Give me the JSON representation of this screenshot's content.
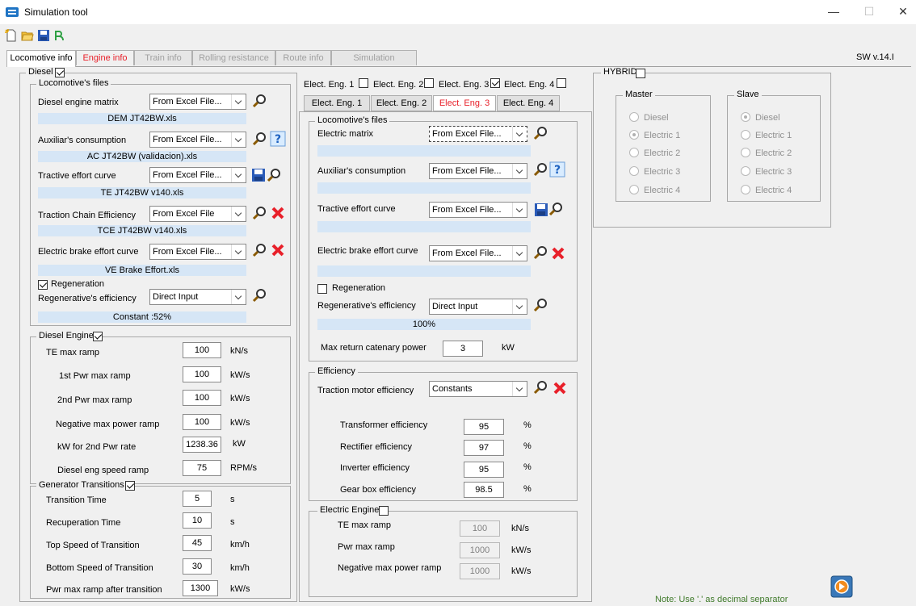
{
  "window": {
    "title": "Simulation tool",
    "minimize": "—",
    "maximize": "☐",
    "close": "✕"
  },
  "colors": {
    "accent_red": "#e8202a",
    "file_bar": "#d6e6f6",
    "logo_blue": "#1f74c4"
  },
  "tabs": [
    {
      "label": "Locomotive info"
    },
    {
      "label": "Engine info"
    },
    {
      "label": "Train info"
    },
    {
      "label": "Rolling resistance"
    },
    {
      "label": "Route info"
    },
    {
      "label": "Simulation"
    }
  ],
  "version": "SW v.14.I",
  "diesel": {
    "title": "Diesel",
    "files": {
      "title": "Locomotive's files",
      "rows": [
        {
          "label": "Diesel engine matrix",
          "combo": "From Excel File...",
          "file": "DEM JT42BW.xls"
        },
        {
          "label": "Auxiliar's consumption",
          "combo": "From Excel File...",
          "file": "AC JT42BW (validacion).xls"
        },
        {
          "label": "Tractive effort curve",
          "combo": "From Excel File...",
          "file": "TE JT42BW v140.xls"
        },
        {
          "label": "Traction Chain Efficiency",
          "combo": "From Excel File",
          "file": "TCE JT42BW v140.xls"
        },
        {
          "label": "Electric brake effort curve",
          "combo": "From Excel File...",
          "file": "VE Brake Effort.xls"
        }
      ],
      "regen_label": "Regeneration",
      "regen_eff_label": "Regenerative's  efficiency",
      "regen_combo": "Direct Input",
      "regen_value": "Constant :52%"
    },
    "engine": {
      "title": "Diesel Engine",
      "rows": [
        {
          "label": "TE max ramp",
          "value": "100",
          "unit": "kN/s"
        },
        {
          "label": "1st Pwr max ramp",
          "value": "100",
          "unit": "kW/s"
        },
        {
          "label": "2nd Pwr max ramp",
          "value": "100",
          "unit": "kW/s"
        },
        {
          "label": "Negative max power ramp",
          "value": "100",
          "unit": "kW/s"
        },
        {
          "label": "kW for 2nd Pwr rate",
          "value": "1238.36",
          "unit": "kW"
        },
        {
          "label": "Diesel eng speed ramp",
          "value": "75",
          "unit": "RPM/s"
        }
      ]
    },
    "generator": {
      "title": "Generator Transitions",
      "rows": [
        {
          "label": "Transition Time",
          "value": "5",
          "unit": "s"
        },
        {
          "label": "Recuperation Time",
          "value": "10",
          "unit": "s"
        },
        {
          "label": "Top Speed of Transition",
          "value": "45",
          "unit": "km/h"
        },
        {
          "label": "Bottom Speed of Transition",
          "value": "30",
          "unit": "km/h"
        },
        {
          "label": "Pwr max ramp after transition",
          "value": "1300",
          "unit": "kW/s"
        }
      ]
    }
  },
  "electric": {
    "engine_checks": [
      {
        "label": "Elect. Eng. 1",
        "checked": false
      },
      {
        "label": "Elect. Eng. 2",
        "checked": false
      },
      {
        "label": "Elect. Eng. 3",
        "checked": true
      },
      {
        "label": "Elect. Eng. 4",
        "checked": false
      }
    ],
    "engine_tabs": [
      "Elect. Eng. 1",
      "Elect. Eng. 2",
      "Elect. Eng. 3",
      "Elect. Eng. 4"
    ],
    "files": {
      "title": "Locomotive's files",
      "rows": [
        {
          "label": "Electric  matrix",
          "combo": "From Excel File..."
        },
        {
          "label": "Auxiliar's consumption",
          "combo": "From Excel File..."
        },
        {
          "label": "Tractive effort curve",
          "combo": "From Excel File..."
        },
        {
          "label": "Electric brake effort curve",
          "combo": "From Excel File..."
        }
      ],
      "regen_label": "Regeneration",
      "regen_eff_label": "Regenerative's  efficiency",
      "regen_combo": "Direct Input",
      "regen_value": "100%",
      "catenary_label": "Max return catenary power",
      "catenary_value": "3",
      "catenary_unit": "kW"
    },
    "efficiency": {
      "title": "Efficiency",
      "motor_label": "Traction motor efficiency",
      "motor_combo": "Constants",
      "rows": [
        {
          "label": "Transformer efficiency",
          "value": "95",
          "unit": "%"
        },
        {
          "label": "Rectifier efficiency",
          "value": "97",
          "unit": "%"
        },
        {
          "label": "Inverter efficiency",
          "value": "95",
          "unit": "%"
        },
        {
          "label": "Gear box efficiency",
          "value": "98.5",
          "unit": "%"
        }
      ]
    },
    "engine": {
      "title": "Electric Engine",
      "rows": [
        {
          "label": "TE max ramp",
          "value": "100",
          "unit": "kN/s"
        },
        {
          "label": "Pwr max ramp",
          "value": "1000",
          "unit": "kW/s"
        },
        {
          "label": "Negative max power ramp",
          "value": "1000",
          "unit": "kW/s"
        }
      ]
    }
  },
  "hybrid": {
    "title": "HYBRID",
    "master": {
      "title": "Master",
      "options": [
        "Diesel",
        "Electric 1",
        "Electric 2",
        "Electric 3",
        "Electric 4"
      ],
      "selected": 1
    },
    "slave": {
      "title": "Slave",
      "options": [
        "Diesel",
        "Electric 1",
        "Electric 2",
        "Electric 3",
        "Electric 4"
      ],
      "selected": 0
    }
  },
  "note": "Note: Use '.' as decimal separator"
}
